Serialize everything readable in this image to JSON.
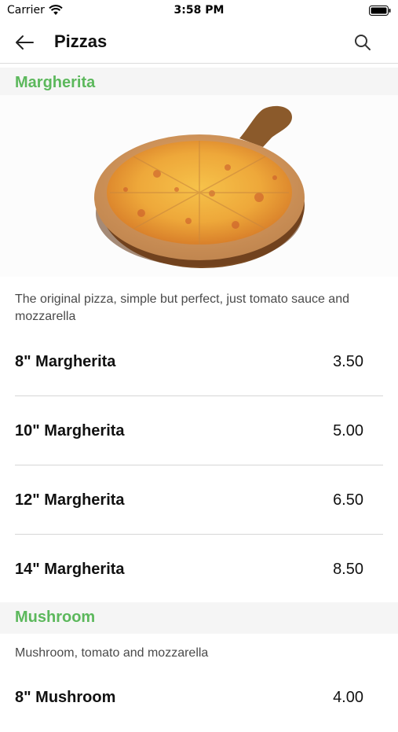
{
  "status_bar": {
    "carrier": "Carrier",
    "time": "3:58 PM"
  },
  "nav": {
    "title": "Pizzas",
    "back_icon": "arrow-left-icon",
    "search_icon": "search-icon"
  },
  "colors": {
    "accent_green": "#5cb85c",
    "section_bg": "#f5f5f5",
    "divider": "#d6d6d6"
  },
  "sections": [
    {
      "name": "Margherita",
      "image": "margherita-pizza-image",
      "description": "The original pizza, simple but perfect, just tomato sauce and mozzarella",
      "items": [
        {
          "name": "8\" Margherita",
          "price": "3.50"
        },
        {
          "name": "10\" Margherita",
          "price": "5.00"
        },
        {
          "name": "12\" Margherita",
          "price": "6.50"
        },
        {
          "name": "14\" Margherita",
          "price": "8.50"
        }
      ]
    },
    {
      "name": "Mushroom",
      "description": "Mushroom, tomato and mozzarella",
      "items": [
        {
          "name": "8\" Mushroom",
          "price": "4.00"
        }
      ]
    }
  ]
}
